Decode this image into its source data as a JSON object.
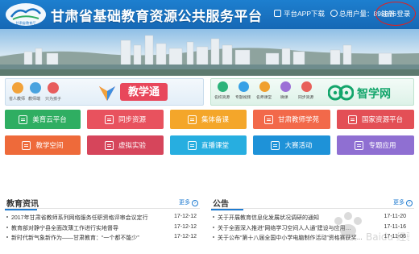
{
  "header": {
    "title": "甘肃省基础教育资源公共服务平台",
    "logo_text": "甘肃省教育厅",
    "app_download": "平台APP下载",
    "total_users_label": "总用户量：",
    "total_users_value": "898876",
    "register_label": "注册",
    "login_label": "登录",
    "accent": "#1a74c4",
    "highlight_ring_color": "#e02020"
  },
  "portals": {
    "jiaoxuetong": {
      "name": "教学通",
      "avatars": [
        {
          "label": "省人教师",
          "color": "#f2a23a"
        },
        {
          "label": "教师端",
          "color": "#4aa3df"
        },
        {
          "label": "只为孩子",
          "color": "#e85d5d"
        }
      ],
      "brand_color": "#e8475b"
    },
    "zhixuewang": {
      "name": "智学网",
      "icons": [
        {
          "label": "名校资源",
          "color": "#2db37a"
        },
        {
          "label": "专题视频",
          "color": "#37a0e6"
        },
        {
          "label": "名师课堂",
          "color": "#f0a030"
        },
        {
          "label": "微课",
          "color": "#9c6fd6"
        },
        {
          "label": "同步资源",
          "color": "#e8605a"
        }
      ],
      "brand_color": "#13a56b"
    }
  },
  "tiles": [
    {
      "label": "美育云平台",
      "color": "#2fae62",
      "icon": "cloud-icon"
    },
    {
      "label": "同步资源",
      "color": "#e8525e",
      "icon": "book-icon"
    },
    {
      "label": "集体备课",
      "color": "#f4a62a",
      "icon": "edit-icon"
    },
    {
      "label": "甘肃教师学苑",
      "color": "#f2694a",
      "icon": "briefcase-icon"
    },
    {
      "label": "国家资源平台",
      "color": "#e34f56",
      "icon": "building-icon"
    },
    {
      "label": "教学空间",
      "color": "#ee6a3a",
      "icon": "person-icon"
    },
    {
      "label": "虚拟实验",
      "color": "#d6455b",
      "icon": "flask-icon"
    },
    {
      "label": "直播课堂",
      "color": "#27aee0",
      "icon": "tv-icon"
    },
    {
      "label": "大赛活动",
      "color": "#1e92d8",
      "icon": "chat-icon"
    },
    {
      "label": "专题应用",
      "color": "#8f6fd2",
      "icon": "flag-icon"
    }
  ],
  "news": {
    "title": "教育资讯",
    "more": "更多",
    "items": [
      {
        "title": "2017年甘肃省教师系列网络服务任职资格评审会议定行",
        "date": "17-12-12"
      },
      {
        "title": "教育部对静宁县全面改薄工作进行实地督导",
        "date": "17-12-12"
      },
      {
        "title": "新时代新气象新作为——甘肃教育：“一个都不能少”",
        "date": "17-12-12"
      }
    ]
  },
  "notice": {
    "title": "公告",
    "more": "更多",
    "items": [
      {
        "title": "关于开展教育信息化发展状况调研的通知",
        "date": "17-11-20"
      },
      {
        "title": "关于全面深入推进“网络学习空间人人通”建设与应用…",
        "date": "17-11-16"
      },
      {
        "title": "关于公布“第十八届全国中小学电脑制作活动”资格赛获奖…",
        "date": "17-11-06"
      }
    ]
  },
  "watermark_text": "Baidu 经验"
}
